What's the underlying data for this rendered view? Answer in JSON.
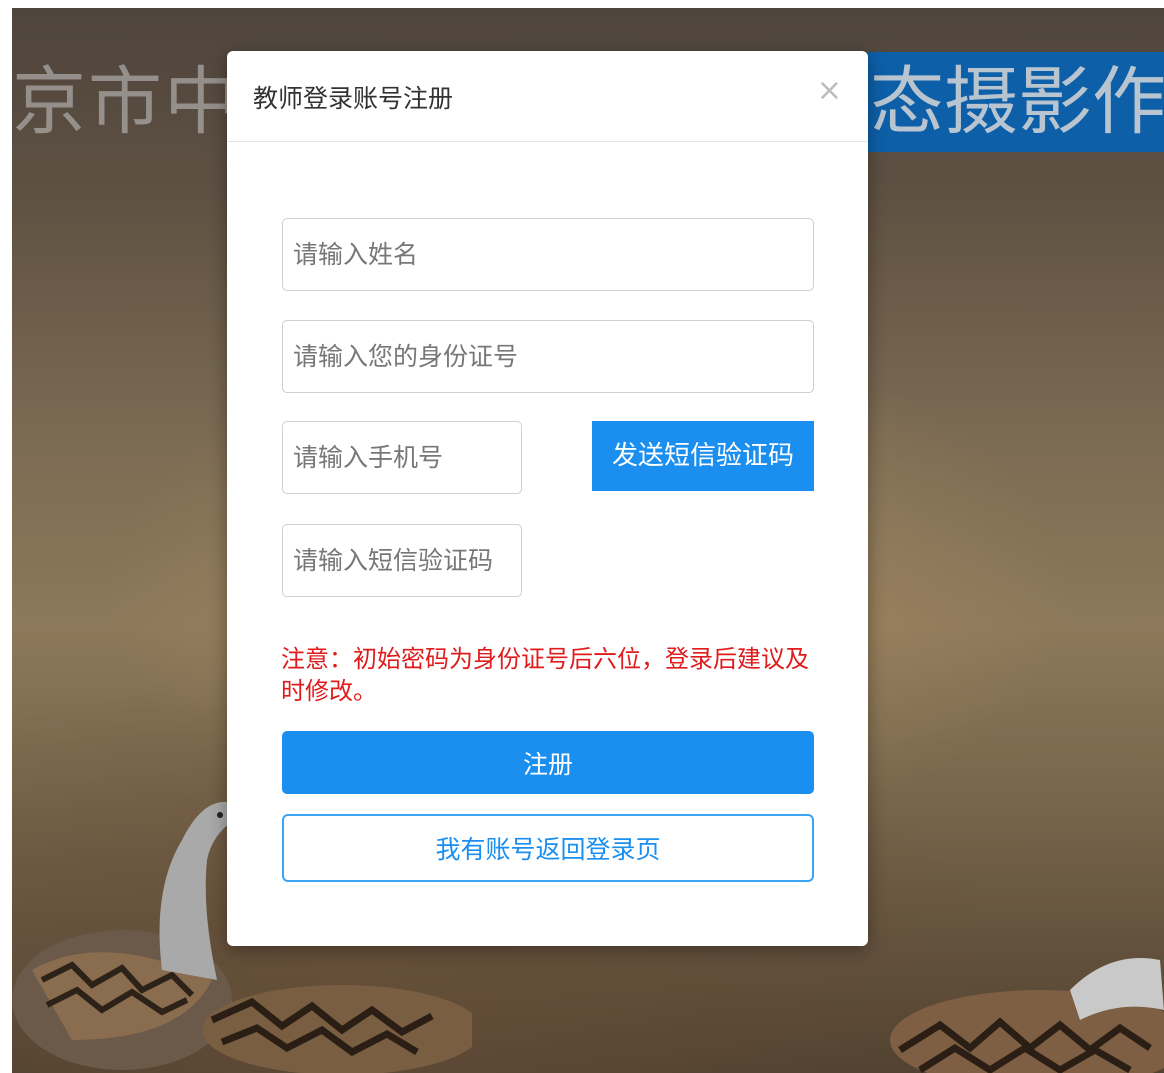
{
  "background": {
    "banner_left_text": "京市中小",
    "banner_right_text": "态摄影作品"
  },
  "modal": {
    "title": "教师登录账号注册",
    "close_symbol": "×",
    "name_placeholder": "请输入姓名",
    "id_placeholder": "请输入您的身份证号",
    "phone_placeholder": "请输入手机号",
    "sms_code_placeholder": "请输入短信验证码",
    "send_sms_label": "发送短信验证码",
    "notice": "注意：初始密码为身份证号后六位，登录后建议及时修改。",
    "register_label": "注册",
    "back_label": "我有账号返回登录页"
  },
  "colors": {
    "primary": "#1b8ff0",
    "notice_red": "#e01b1b",
    "banner_blue": "#0d5fa8"
  }
}
